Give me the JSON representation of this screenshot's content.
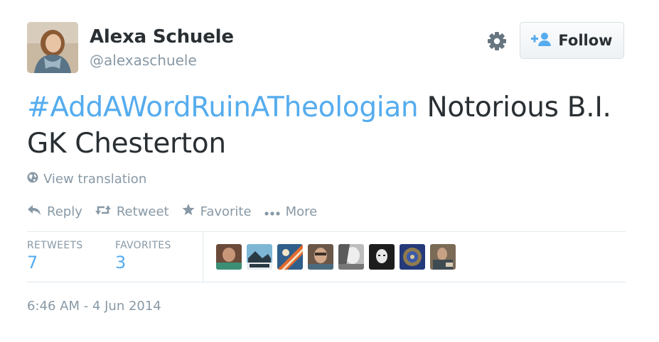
{
  "tweet": {
    "author": {
      "display_name": "Alexa Schuele",
      "username": "@alexaschuele"
    },
    "follow_label": "Follow",
    "text_hashtag": "#AddAWordRuinATheologian",
    "text_body": " Notorious B.I. GK Chesterton",
    "view_translation": "View translation",
    "actions": {
      "reply": "Reply",
      "retweet": "Retweet",
      "favorite": "Favorite",
      "more": "More"
    },
    "stats": {
      "retweets_label": "RETWEETS",
      "retweets_count": "7",
      "favorites_label": "FAVORITES",
      "favorites_count": "3"
    },
    "timestamp": "6:46 AM - 4 Jun 2014"
  },
  "colors": {
    "link": "#55acee",
    "muted": "#8899a6",
    "text": "#292f33"
  },
  "icons": [
    "gear-icon",
    "follow-person-plus-icon",
    "globe-icon",
    "reply-arrow-icon",
    "retweet-icon",
    "star-icon",
    "more-dots-icon"
  ]
}
